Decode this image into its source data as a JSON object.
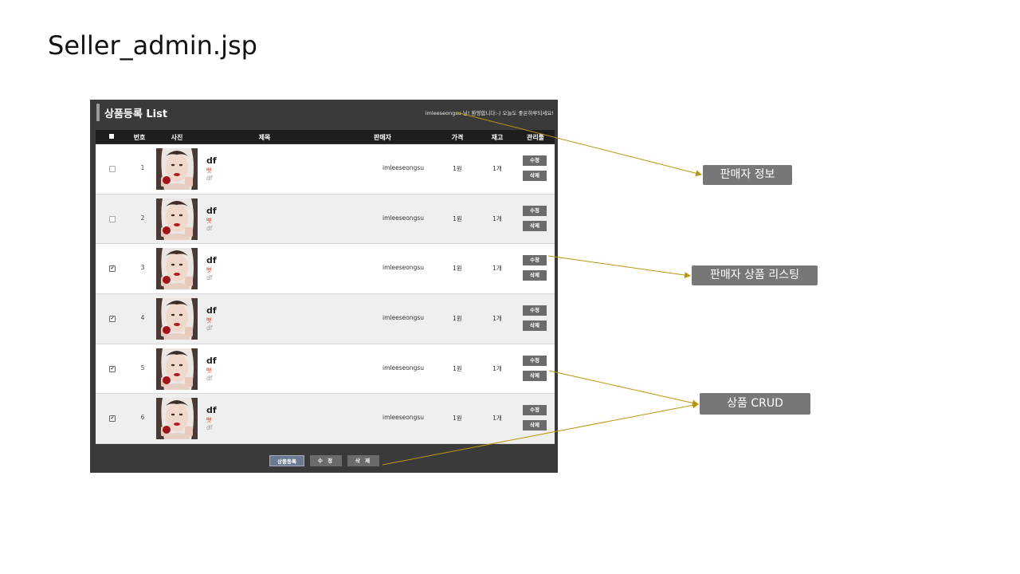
{
  "slide_title": "Seller_admin.jsp",
  "panel": {
    "title": "상품등록 List",
    "welcome": "imleeseongsu 님! 환영합니다:-) 오늘도 좋은하루되세요!"
  },
  "table": {
    "headers": [
      "■",
      "번호",
      "사진",
      "제목",
      "판매자",
      "가격",
      "재고",
      "관리툴"
    ],
    "rows": [
      {
        "no": "1",
        "checked": false,
        "title": "df",
        "subtitle": "뻣",
        "desc": "df",
        "seller": "imleeseongsu",
        "price": "1원",
        "stock": "1개",
        "edit": "수정",
        "delete": "삭제"
      },
      {
        "no": "2",
        "checked": false,
        "title": "df",
        "subtitle": "뻣",
        "desc": "df",
        "seller": "imleeseongsu",
        "price": "1원",
        "stock": "1개",
        "edit": "수정",
        "delete": "삭제"
      },
      {
        "no": "3",
        "checked": true,
        "title": "df",
        "subtitle": "뻣",
        "desc": "df",
        "seller": "imleeseongsu",
        "price": "1원",
        "stock": "1개",
        "edit": "수정",
        "delete": "삭제"
      },
      {
        "no": "4",
        "checked": true,
        "title": "df",
        "subtitle": "뻣",
        "desc": "df",
        "seller": "imleeseongsu",
        "price": "1원",
        "stock": "1개",
        "edit": "수정",
        "delete": "삭제"
      },
      {
        "no": "5",
        "checked": true,
        "title": "df",
        "subtitle": "뻣",
        "desc": "df",
        "seller": "imleeseongsu",
        "price": "1원",
        "stock": "1개",
        "edit": "수정",
        "delete": "삭제"
      },
      {
        "no": "6",
        "checked": true,
        "title": "df",
        "subtitle": "뻣",
        "desc": "df",
        "seller": "imleeseongsu",
        "price": "1원",
        "stock": "1개",
        "edit": "수정",
        "delete": "삭제"
      }
    ]
  },
  "footer_buttons": {
    "register": "상품등록",
    "edit": "수 정",
    "delete": "삭 제"
  },
  "callouts": {
    "seller_info": "판매자 정보",
    "seller_listing": "판매자 상품 리스팅",
    "crud": "상품 CRUD"
  },
  "colors": {
    "panel_bg": "#3a3a3a",
    "callout_bg": "#777777",
    "arrow": "#b8960c"
  }
}
